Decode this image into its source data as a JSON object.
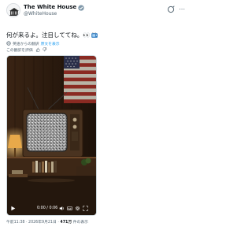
{
  "header": {
    "display_name": "The White House",
    "handle": "@WhiteHouse",
    "avatar_icon": "white-house-seal-icon",
    "verified_icon": "verified-badge-icon",
    "verified_color": "#829aab",
    "grok_icon": "grok-icon",
    "more_icon": "more-options-icon"
  },
  "tweet": {
    "text": "何が来るよ。注目しててね。👀",
    "emoji_icon": "television-icon"
  },
  "translation": {
    "note": "英語からの翻訳",
    "show_original": "原文を表示",
    "rate": "この翻訳を評価",
    "link_color": "#1d9bf0"
  },
  "video": {
    "scene": "vintage-tv-static-room",
    "time": "0:00 / 0:06",
    "play_icon": "play-icon",
    "volume_icon": "volume-icon",
    "captions_icon": "captions-icon",
    "settings_icon": "settings-gear-icon",
    "fullscreen_icon": "fullscreen-icon"
  },
  "footer": {
    "time": "午前11:38",
    "date": "2026年9月21日",
    "views_count": "471万",
    "views_label": "件の表示",
    "separator": "·"
  }
}
